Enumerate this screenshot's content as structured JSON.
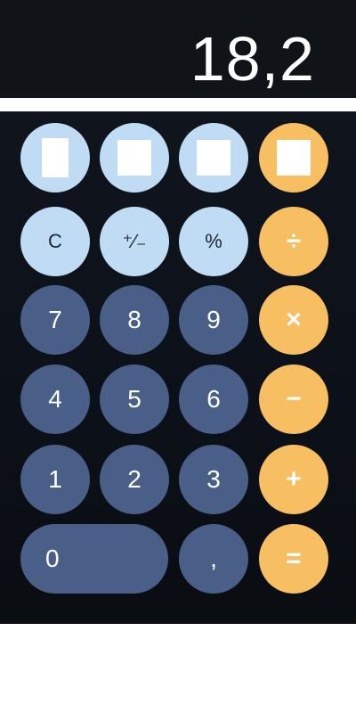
{
  "display": {
    "value": "18,2"
  },
  "keys": {
    "clear": "C",
    "sign": "⁺∕₋",
    "percent": "%",
    "divide": "÷",
    "seven": "7",
    "eight": "8",
    "nine": "9",
    "multiply": "×",
    "four": "4",
    "five": "5",
    "six": "6",
    "minus": "−",
    "one": "1",
    "two": "2",
    "three": "3",
    "plus": "+",
    "zero": "0",
    "decimal": ",",
    "equals": "="
  },
  "colors": {
    "function_key": "#bfdcf4",
    "digit_key": "#4a5f87",
    "operator_key": "#f7be62",
    "background": "#0c1018"
  }
}
